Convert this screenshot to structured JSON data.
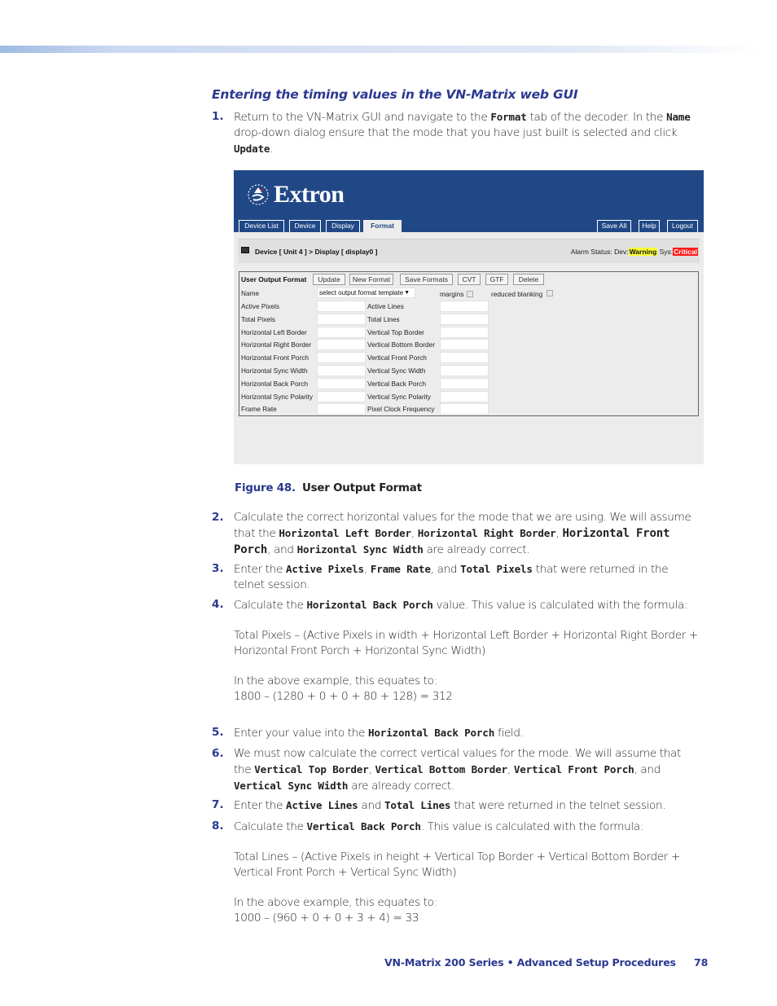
{
  "section_heading": "Entering the timing values in the VN-Matrix web GUI",
  "steps": [
    {
      "num": "1.",
      "parts": [
        {
          "t": "Return to the VN-Matrix GUI and navigate to the "
        },
        {
          "m": "Format"
        },
        {
          "t": " tab of the decoder. In the "
        },
        {
          "m": "Name"
        },
        {
          "t": " drop-down dialog ensure that the mode that you have just built is selected and click "
        },
        {
          "m": "Update"
        },
        {
          "t": "."
        }
      ]
    },
    {
      "num": "2.",
      "parts": [
        {
          "t": "Calculate the correct horizontal values for the mode that we are using. We will assume that the "
        },
        {
          "m": "Horizontal Left Border"
        },
        {
          "t": ", "
        },
        {
          "m": "Horizontal Right Border"
        },
        {
          "t": ", "
        },
        {
          "ml": "Horizontal Front Porch"
        },
        {
          "t": ", and "
        },
        {
          "m": "Horizontal Sync Width"
        },
        {
          "t": " are already correct."
        }
      ]
    },
    {
      "num": "3.",
      "parts": [
        {
          "t": "Enter the "
        },
        {
          "m": "Active Pixels"
        },
        {
          "t": ", "
        },
        {
          "m": "Frame Rate"
        },
        {
          "t": ", and "
        },
        {
          "m": "Total Pixels"
        },
        {
          "t": " that were returned in the telnet session."
        }
      ]
    },
    {
      "num": "4.",
      "parts": [
        {
          "t": "Calculate the "
        },
        {
          "m": "Horizontal Back Porch"
        },
        {
          "t": " value. This value is calculated with the formula:"
        },
        {
          "br": true
        },
        {
          "t": "Total Pixels – (Active Pixels in width + Horizontal Left Border + Horizontal Right Border + Horizontal Front Porch + Horizontal Sync Width)"
        },
        {
          "br": true
        },
        {
          "t": "In the above example, this equates to:"
        },
        {
          "nl": true
        },
        {
          "t": "1800 – (1280 + 0 + 0 + 80 + 128) = 312"
        }
      ]
    },
    {
      "num": "5.",
      "parts": [
        {
          "t": "Enter your value into the "
        },
        {
          "m": "Horizontal Back Porch"
        },
        {
          "t": " field."
        }
      ]
    },
    {
      "num": "6.",
      "parts": [
        {
          "t": "We must now calculate the correct vertical values for the mode. We will assume that the "
        },
        {
          "m": "Vertical Top Border"
        },
        {
          "t": ", "
        },
        {
          "m": "Vertical Bottom Border"
        },
        {
          "t": ", "
        },
        {
          "m": "Vertical Front Porch"
        },
        {
          "t": ", and "
        },
        {
          "m": "Vertical Sync Width"
        },
        {
          "t": " are already correct."
        }
      ]
    },
    {
      "num": "7.",
      "parts": [
        {
          "t": "Enter the "
        },
        {
          "m": "Active Lines"
        },
        {
          "t": " and "
        },
        {
          "m": "Total Lines"
        },
        {
          "t": " that were returned in the telnet session."
        }
      ]
    },
    {
      "num": "8.",
      "parts": [
        {
          "t": "Calculate the "
        },
        {
          "m": "Vertical Back Porch"
        },
        {
          "t": ". This value is calculated with the formula:"
        },
        {
          "br": true
        },
        {
          "t": "Total Lines – (Active Pixels in height + Vertical Top Border + Vertical Bottom Border + Vertical Front Porch + Vertical Sync Width)"
        },
        {
          "br": true
        },
        {
          "t": "In the above example, this equates to:"
        },
        {
          "nl": true
        },
        {
          "t": "1000 – (960 + 0 + 0 + 3 + 4) = 33"
        }
      ]
    }
  ],
  "gui": {
    "logo_text": "Extron",
    "tabs_left": [
      "Device List",
      "Device",
      "Display",
      "Format"
    ],
    "active_tab": "Format",
    "tabs_right": [
      "Save All",
      "Help",
      "Logout"
    ],
    "breadcrumb": "Device [ Unit 4 ]  >  Display [ display0 ]",
    "alarm_label": "Alarm Status: Dev:",
    "alarm_dev": "Warning",
    "alarm_sys_label": " Sys:",
    "alarm_sys": "Critical",
    "form_title": "User Output Format",
    "buttons": [
      "Update",
      "New Format",
      "Save Formats",
      "CVT",
      "GTF",
      "Delete"
    ],
    "name_label": "Name",
    "name_select": "select output format template",
    "margins_label": "margins",
    "reduced_blanking_label": "reduced blanking",
    "left_fields": [
      "Active Pixels",
      "Total Pixels",
      "Horizontal Left Border",
      "Horizontal Right Border",
      "Horizontal Front Porch",
      "Horizontal Sync Width",
      "Horizontal Back Porch",
      "Horizontal Sync Polarity",
      "Frame Rate"
    ],
    "right_fields": [
      "Active Lines",
      "Total Lines",
      "Vertical Top Border",
      "Vertical Bottom Border",
      "Vertical Front Porch",
      "Vertical Sync Width",
      "Vertical Back Porch",
      "Vertical Sync Polarity",
      "Pixel Clock Frequency"
    ]
  },
  "figure": {
    "number": "Figure 48.",
    "title": "User Output Format"
  },
  "footer": {
    "text": "VN-Matrix 200 Series  • Advanced Setup Procedures",
    "page": "78"
  },
  "colors": {
    "accent_blue": "#2b3990",
    "gui_header": "#214886",
    "warning": "#ffff33",
    "critical": "#ff1a1a"
  }
}
